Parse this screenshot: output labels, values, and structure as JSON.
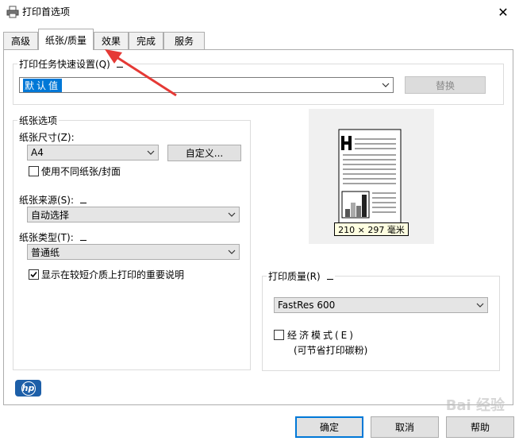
{
  "window": {
    "title": "打印首选项",
    "close_glyph": "✕"
  },
  "tabs": [
    {
      "label": "高级"
    },
    {
      "label": "纸张/质量"
    },
    {
      "label": "效果"
    },
    {
      "label": "完成"
    },
    {
      "label": "服务"
    }
  ],
  "quick_settings": {
    "legend": "打印任务快速设置(Q)",
    "value": "默认值",
    "replace_label": "替换"
  },
  "paper_options": {
    "legend": "纸张选项",
    "size_label": "纸张尺寸(Z):",
    "size_value": "A4",
    "custom_label": "自定义...",
    "diff_paper_label": "使用不同纸张/封面",
    "diff_paper_checked": false,
    "source_label": "纸张来源(S):",
    "source_value": "自动选择",
    "type_label": "纸张类型(T):",
    "type_value": "普通纸",
    "show_notes_label": "显示在较短介质上打印的重要说明",
    "show_notes_checked": true
  },
  "preview": {
    "dimension_label": "210 × 297 毫米"
  },
  "print_quality": {
    "legend": "打印质量(R)",
    "value": "FastRes 600",
    "economode_label": "经济模式(E)",
    "economode_checked": false,
    "economode_note": "(可节省打印碳粉)"
  },
  "footer": {
    "logo_text": "hp",
    "ok_label": "确定",
    "cancel_label": "取消",
    "help_label": "帮助",
    "watermark": "Bai 经验"
  },
  "colors": {
    "accent": "#0078d7",
    "annotation_arrow": "#e53935",
    "hp_blue": "#1d5fa8"
  }
}
